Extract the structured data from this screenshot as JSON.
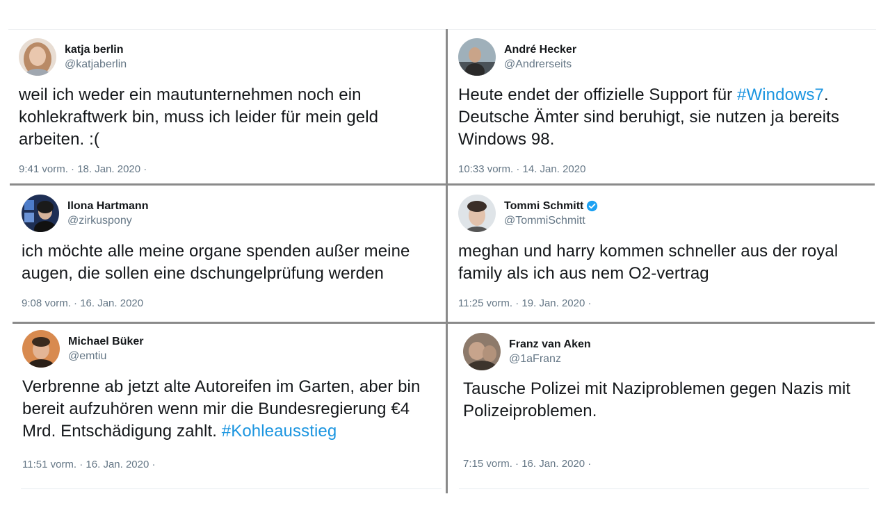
{
  "tweets": [
    {
      "name": "katja berlin",
      "handle": "@katjaberlin",
      "text_parts": [
        "weil ich weder ein mautunternehmen noch ein kohlekraftwerk bin, muss ich leider für mein geld arbeiten. :(",
        ""
      ],
      "hashtag": "",
      "meta": "9:41 vorm. · 18. Jan. 2020 ·",
      "verified": false,
      "avatar_icon": "person-avatar-icon",
      "avatar_colors": [
        "#c9a58d",
        "#5a3b2a"
      ]
    },
    {
      "name": "André Hecker",
      "handle": "@Andrerseits",
      "text_parts": [
        "Heute endet der offizielle Support für ",
        ". Deutsche Ämter sind beruhigt, sie nutzen ja bereits Windows 98."
      ],
      "hashtag": "#Windows7",
      "meta": "10:33 vorm. · 14. Jan. 2020",
      "verified": false,
      "avatar_icon": "person-avatar-icon",
      "avatar_colors": [
        "#8fa2ad",
        "#2a2a2a"
      ]
    },
    {
      "name": "Ilona Hartmann",
      "handle": "@zirkuspony",
      "text_parts": [
        "ich möchte alle meine organe spenden außer meine augen, die sollen eine dschungelprüfung werden",
        ""
      ],
      "hashtag": "",
      "meta": "9:08 vorm. · 16. Jan. 2020",
      "verified": false,
      "avatar_icon": "person-avatar-icon",
      "avatar_colors": [
        "#3b5fa8",
        "#1a1a1a"
      ]
    },
    {
      "name": "Tommi Schmitt",
      "handle": "@TommiSchmitt",
      "text_parts": [
        "meghan und harry kommen schneller aus der royal family als ich aus nem O2-vertrag",
        ""
      ],
      "hashtag": "",
      "meta": "11:25 vorm. · 19. Jan. 2020 ·",
      "verified": true,
      "avatar_icon": "person-avatar-icon",
      "avatar_colors": [
        "#d7dde2",
        "#3a2e28"
      ]
    },
    {
      "name": "Michael Büker",
      "handle": "@emtiu",
      "text_parts": [
        "Verbrenne ab jetzt alte Autoreifen im Garten, aber bin bereit aufzuhören wenn mir die Bundesregierung €4 Mrd. Entschädigung zahlt. ",
        ""
      ],
      "hashtag": "#Kohleausstieg",
      "meta": "11:51 vorm. · 16. Jan. 2020 ·",
      "verified": false,
      "avatar_icon": "person-avatar-icon",
      "avatar_colors": [
        "#c9784a",
        "#2b2018"
      ]
    },
    {
      "name": "Franz van Aken",
      "handle": "@1aFranz",
      "text_parts": [
        "Tausche Polizei mit Naziproblemen gegen Nazis mit Polizeiproblemen.",
        ""
      ],
      "hashtag": "",
      "meta": "7:15 vorm. · 16. Jan. 2020 ·",
      "verified": false,
      "avatar_icon": "person-avatar-icon",
      "avatar_colors": [
        "#9a8778",
        "#3d342c"
      ]
    }
  ],
  "colors": {
    "text": "#14171a",
    "secondary": "#657786",
    "link": "#1b95e0",
    "verified": "#1da1f2",
    "divider": "#8a8a8a"
  }
}
